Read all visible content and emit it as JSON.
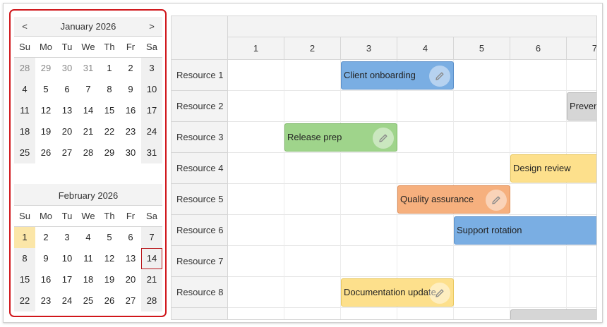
{
  "navigator": {
    "prev_label": "<",
    "next_label": ">",
    "weekdays": [
      "Su",
      "Mo",
      "Tu",
      "We",
      "Th",
      "Fr",
      "Sa"
    ],
    "months": [
      {
        "title": "January 2026",
        "weeks": [
          [
            "28",
            "29",
            "30",
            "31",
            "1",
            "2",
            "3"
          ],
          [
            "4",
            "5",
            "6",
            "7",
            "8",
            "9",
            "10"
          ],
          [
            "11",
            "12",
            "13",
            "14",
            "15",
            "16",
            "17"
          ],
          [
            "18",
            "19",
            "20",
            "21",
            "22",
            "23",
            "24"
          ],
          [
            "25",
            "26",
            "27",
            "28",
            "29",
            "30",
            "31"
          ]
        ],
        "other_month_days": [
          [
            0,
            0
          ],
          [
            0,
            1
          ],
          [
            0,
            2
          ],
          [
            0,
            3
          ]
        ]
      },
      {
        "title": "February 2026",
        "weeks": [
          [
            "1",
            "2",
            "3",
            "4",
            "5",
            "6",
            "7"
          ],
          [
            "8",
            "9",
            "10",
            "11",
            "12",
            "13",
            "14"
          ],
          [
            "15",
            "16",
            "17",
            "18",
            "19",
            "20",
            "21"
          ],
          [
            "22",
            "23",
            "24",
            "25",
            "26",
            "27",
            "28"
          ]
        ],
        "today": [
          0,
          0
        ],
        "selected": [
          1,
          6
        ]
      }
    ],
    "highlight_color": "#d0161b"
  },
  "scheduler": {
    "columns": [
      "1",
      "2",
      "3",
      "4",
      "5",
      "6",
      "7"
    ],
    "resources": [
      "Resource 1",
      "Resource 2",
      "Resource 3",
      "Resource 4",
      "Resource 5",
      "Resource 6",
      "Resource 7",
      "Resource 8"
    ],
    "events": [
      {
        "text": "Client onboarding",
        "resource": 0,
        "start": 3,
        "end": 4,
        "color": "#7aaee3",
        "border": "#5a8fc9",
        "edit": true
      },
      {
        "text": "Prevent",
        "resource": 1,
        "start": 7,
        "end": 8,
        "color": "#d6d6d6",
        "border": "#b8b8b8",
        "edit": false
      },
      {
        "text": "Release prep",
        "resource": 2,
        "start": 2,
        "end": 3,
        "color": "#9fd48b",
        "border": "#7cb866",
        "edit": true
      },
      {
        "text": "Design review",
        "resource": 3,
        "start": 6,
        "end": 8,
        "color": "#fde08c",
        "border": "#e9c85f",
        "edit": false
      },
      {
        "text": "Quality assurance",
        "resource": 4,
        "start": 4,
        "end": 5,
        "color": "#f6b07e",
        "border": "#e08c55",
        "edit": true
      },
      {
        "text": "Support rotation",
        "resource": 5,
        "start": 5,
        "end": 8,
        "color": "#7aaee3",
        "border": "#5a8fc9",
        "edit": false
      },
      {
        "text": "Documentation update",
        "resource": 7,
        "start": 3,
        "end": 4,
        "color": "#fde08c",
        "border": "#e9c85f",
        "edit": true
      },
      {
        "text": "",
        "resource": 8,
        "start": 6,
        "end": 8,
        "color": "#d6d6d6",
        "border": "#b8b8b8",
        "edit": false
      }
    ],
    "icons": {
      "edit": "pencil-icon"
    }
  }
}
